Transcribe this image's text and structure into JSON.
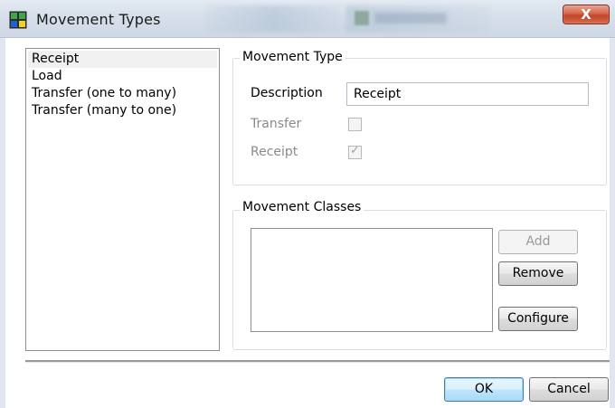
{
  "window": {
    "title": "Movement Types",
    "close_label": "X",
    "icon": "app-grid-icon"
  },
  "movement_list": {
    "items": [
      {
        "label": "Receipt",
        "selected": true
      },
      {
        "label": "Load",
        "selected": false
      },
      {
        "label": "Transfer (one to many)",
        "selected": false
      },
      {
        "label": "Transfer (many to one)",
        "selected": false
      }
    ]
  },
  "movement_type": {
    "group_title": "Movement Type",
    "description_label": "Description",
    "description_value": "Receipt",
    "transfer_label": "Transfer",
    "transfer_checked": false,
    "receipt_label": "Receipt",
    "receipt_checked": true
  },
  "movement_classes": {
    "group_title": "Movement Classes",
    "add_label": "Add",
    "remove_label": "Remove",
    "configure_label": "Configure"
  },
  "footer": {
    "ok_label": "OK",
    "cancel_label": "Cancel"
  },
  "colors": {
    "close_button": "#c1432a",
    "default_button_border": "#3c7fb1"
  }
}
